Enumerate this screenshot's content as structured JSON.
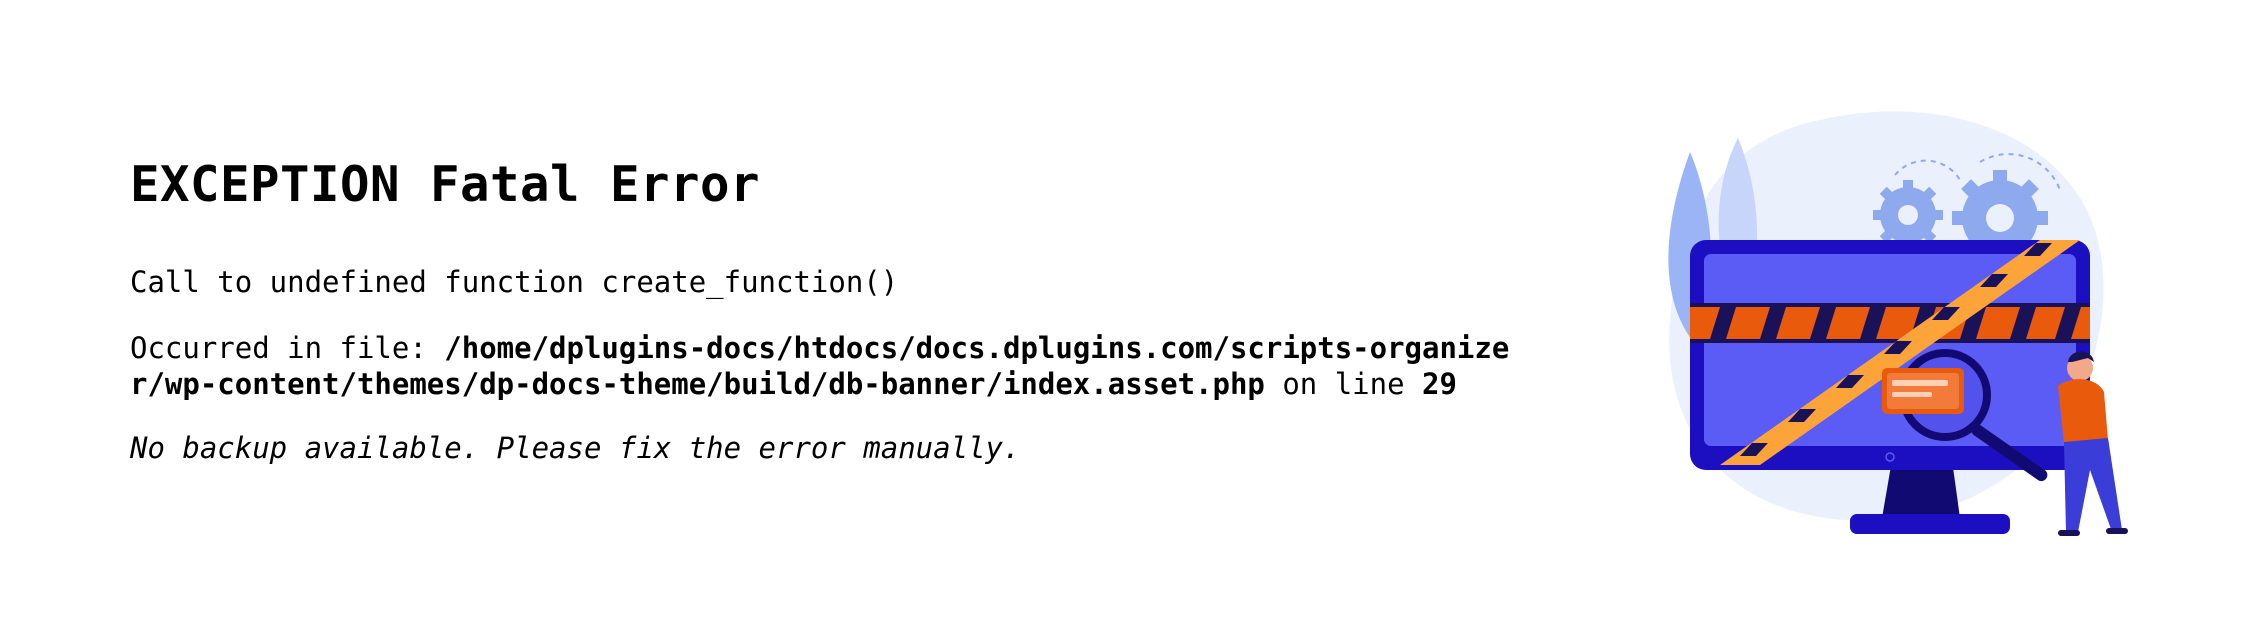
{
  "error": {
    "title": "EXCEPTION Fatal Error",
    "message": "Call to undefined function create_function()",
    "occurred_label": "Occurred in file: ",
    "file_path": "/home/dplugins-docs/htdocs/docs.dplugins.com/scripts-organizer/wp-content/themes/dp-docs-theme/build/db-banner/index.asset.php",
    "on_line_label": " on line ",
    "line_number": "29",
    "note": "No backup available. Please fix the error manually."
  },
  "illustration": {
    "icon": "broken-monitor-maintenance-illustration",
    "colors": {
      "blob": "#eaf1fd",
      "monitor_frame": "#1b0fc1",
      "screen": "#5b5cf6",
      "stand": "#120a73",
      "tape_orange": "#ea5a0c",
      "tape_yellow": "#fca43a",
      "tape_dark": "#1a1258",
      "gear": "#8fa9ee",
      "person_shirt": "#ea5a0c",
      "person_pants": "#3a3dd8"
    }
  }
}
